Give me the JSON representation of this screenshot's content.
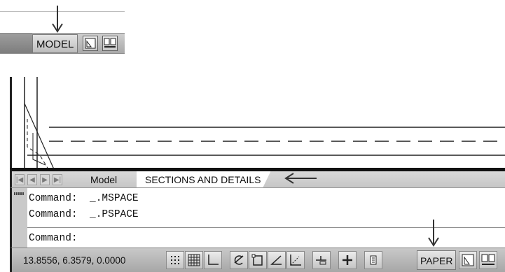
{
  "inset": {
    "model_label": "MODEL"
  },
  "tabs": {
    "nav_first": "|◀",
    "nav_prev": "◀",
    "nav_next": "▶",
    "nav_last": "▶|",
    "model_tab": "Model",
    "layout_tab": "SECTIONS AND DETAILS"
  },
  "command": {
    "history": [
      "Command:  _.MSPACE",
      "Command:  _.PSPACE"
    ],
    "prompt": "Command:"
  },
  "status": {
    "coordinates": "13.8556, 6.3579, 0.0000",
    "space_label": "PAPER"
  },
  "icons": [
    "arrow-down-icon",
    "arrow-left-icon",
    "quick-view-layouts-icon",
    "quick-view-drawings-icon",
    "snap-icon",
    "grid-icon",
    "ortho-icon",
    "polar-icon",
    "osnap-icon",
    "otrack-icon",
    "ducs-icon",
    "dyn-icon",
    "lineweight-icon",
    "quick-properties-icon"
  ]
}
